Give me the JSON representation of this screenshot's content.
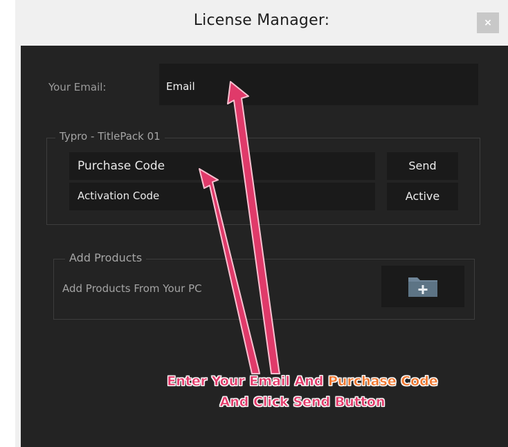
{
  "window": {
    "title": "License Manager:",
    "close_label": "×"
  },
  "email": {
    "label": "Your Email:",
    "value": "Email"
  },
  "license_group": {
    "legend": "Typro - TitlePack 01",
    "purchase_code_value": "Purchase Code",
    "activation_code_value": "Activation Code",
    "send_label": "Send",
    "active_label": "Active"
  },
  "products_group": {
    "legend": "Add Products",
    "description": "Add Products From Your PC",
    "folder_icon": "folder-add-icon"
  },
  "annotation": {
    "line1_part1": "Enter Your Email And",
    "line1_part2": "Purchase Code",
    "line2": "And Click Send Button",
    "color_pink": "#e33b6b",
    "color_orange": "#f0772f"
  },
  "colors": {
    "panel_bg": "#232323",
    "field_bg": "#1a1a1a",
    "titlebar_bg": "#f0f0f0",
    "folder_icon": "#6f8699"
  }
}
